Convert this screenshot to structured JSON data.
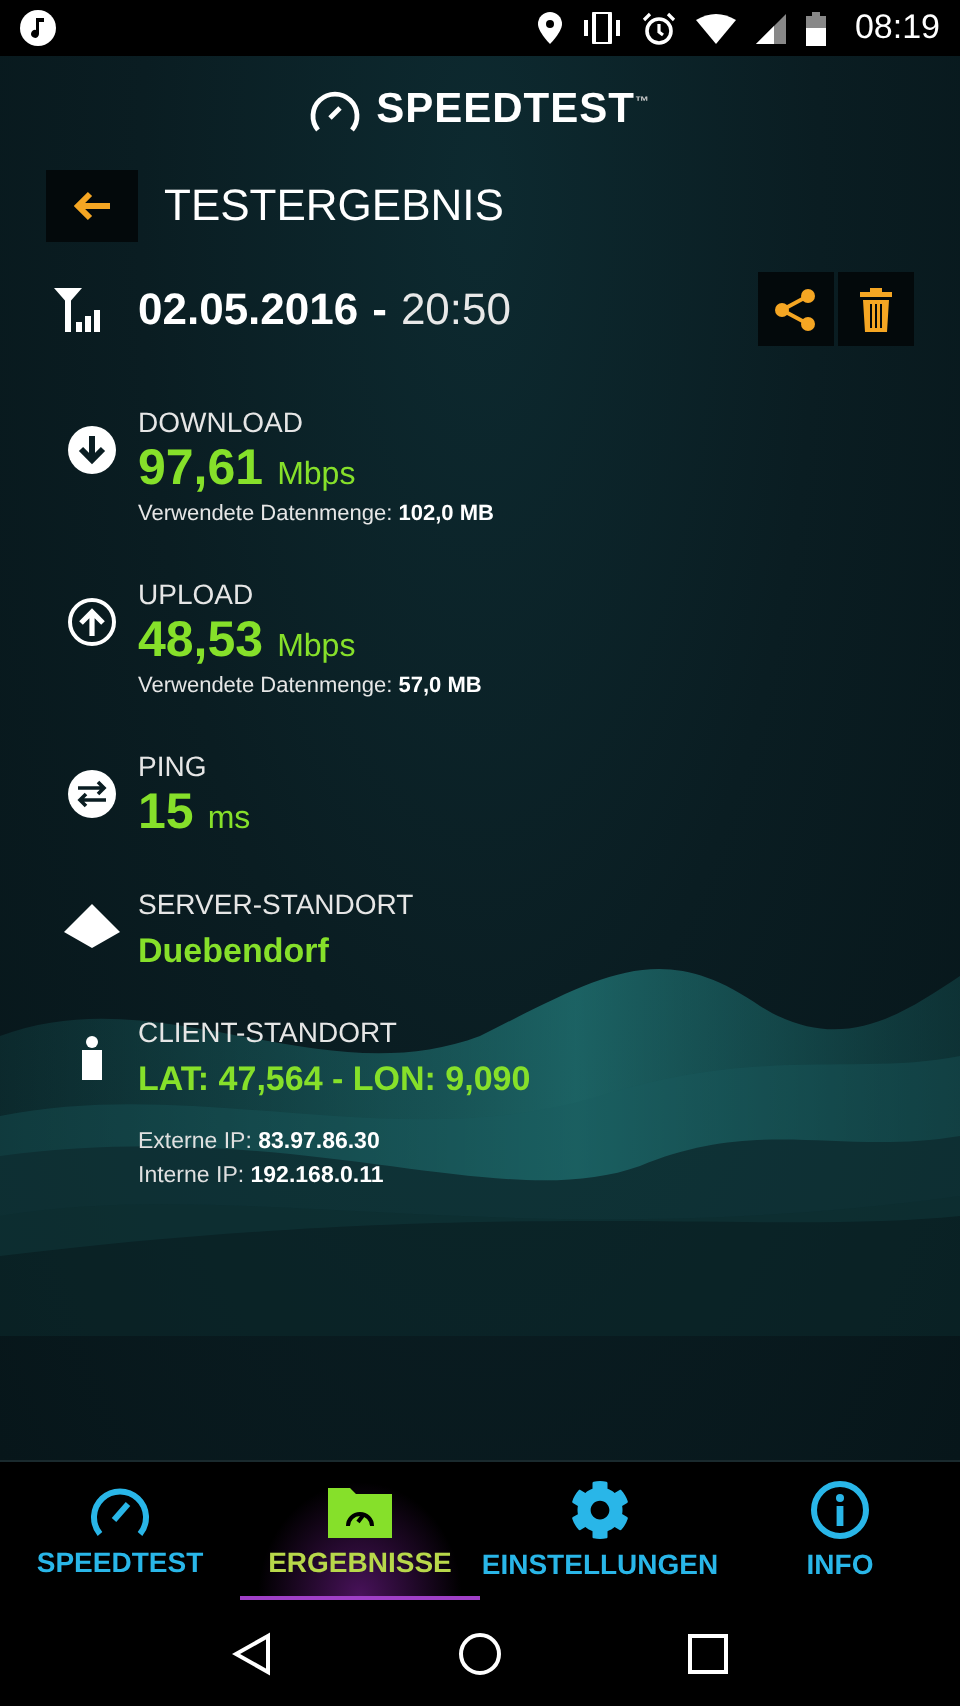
{
  "status_bar": {
    "time": "08:19"
  },
  "app_title": {
    "text": "SPEEDTEST",
    "mark": "™"
  },
  "page_title": "TESTERGEBNIS",
  "result": {
    "date": "02.05.2016",
    "separator": "-",
    "time": "20:50"
  },
  "metrics": [
    {
      "kind": "download",
      "label": "DOWNLOAD",
      "value": "97,61",
      "unit": "Mbps",
      "data_label": "Verwendete Datenmenge:",
      "data_value": "102,0 MB"
    },
    {
      "kind": "upload",
      "label": "UPLOAD",
      "value": "48,53",
      "unit": "Mbps",
      "data_label": "Verwendete Datenmenge:",
      "data_value": "57,0 MB"
    },
    {
      "kind": "ping",
      "label": "PING",
      "value": "15",
      "unit": "ms"
    }
  ],
  "server": {
    "label": "SERVER-STANDORT",
    "value": "Duebendorf"
  },
  "client": {
    "label": "CLIENT-STANDORT",
    "value": "LAT: 47,564 - LON: 9,090",
    "ips": [
      {
        "label": "Externe IP:",
        "value": "83.97.86.30"
      },
      {
        "label": "Interne IP:",
        "value": "192.168.0.11"
      }
    ]
  },
  "nav": [
    {
      "kind": "gauge",
      "label": "SPEEDTEST",
      "selected": false
    },
    {
      "kind": "folder",
      "label": "ERGEBNISSE",
      "selected": true
    },
    {
      "kind": "gear",
      "label": "EINSTELLUNGEN",
      "selected": false
    },
    {
      "kind": "info",
      "label": "INFO",
      "selected": false
    }
  ]
}
